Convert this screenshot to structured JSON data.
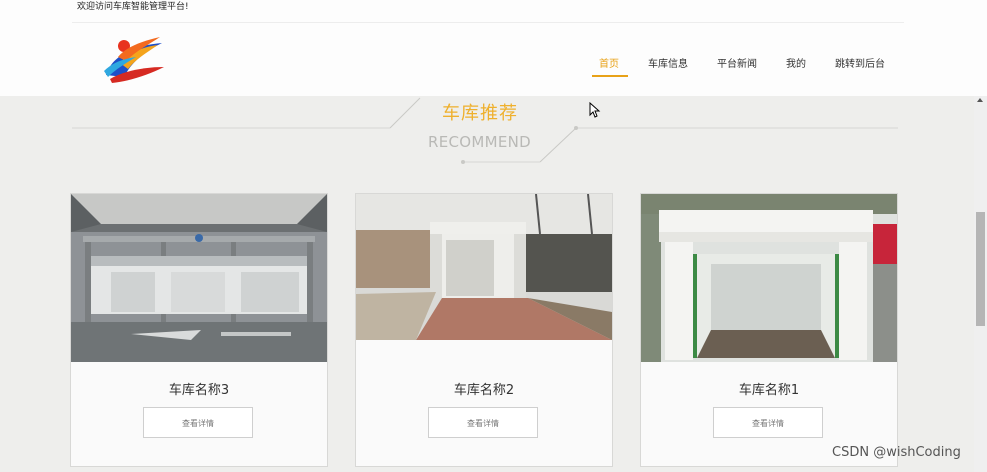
{
  "header": {
    "welcome_text": "欢迎访问车库智能管理平台!",
    "nav": [
      {
        "label": "首页",
        "active": true
      },
      {
        "label": "车库信息",
        "active": false
      },
      {
        "label": "平台新闻",
        "active": false
      },
      {
        "label": "我的",
        "active": false
      },
      {
        "label": "跳转到后台",
        "active": false
      }
    ]
  },
  "section": {
    "title": "车库推荐",
    "subtitle": "RECOMMEND"
  },
  "cards": [
    {
      "name": "车库名称3",
      "button_label": "查看详情"
    },
    {
      "name": "车库名称2",
      "button_label": "查看详情"
    },
    {
      "name": "车库名称1",
      "button_label": "查看详情"
    }
  ],
  "watermark": "CSDN @wishCoding",
  "colors": {
    "accent": "#e8a218",
    "title": "#efb02d",
    "subtitle": "#b9b9b6",
    "background": "#eeeeec"
  },
  "icons": [
    "logo-icon",
    "mouse-cursor-icon",
    "scroll-up-arrow-icon"
  ]
}
